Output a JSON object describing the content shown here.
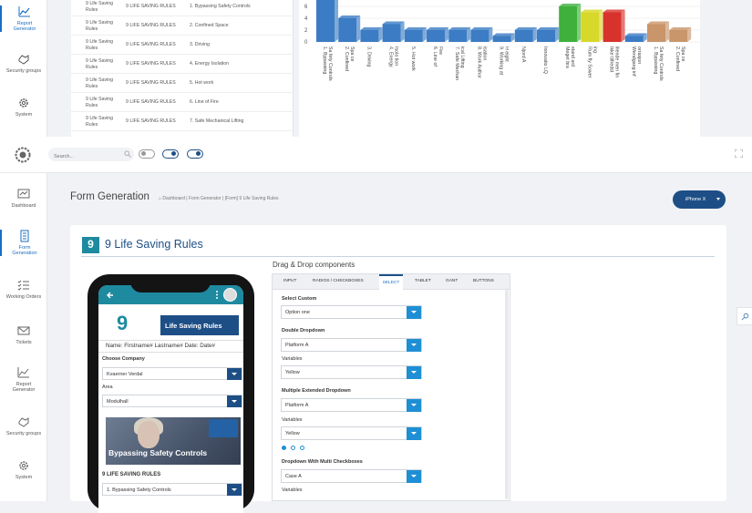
{
  "top": {
    "sidebar": [
      {
        "label_lines": [
          "Report",
          "Generator"
        ],
        "icon": "report-chart-icon",
        "active": true
      },
      {
        "label_lines": [
          "Security groups"
        ],
        "icon": "security-hands-icon",
        "active": false
      },
      {
        "label_lines": [
          "System"
        ],
        "icon": "gear-icon",
        "active": false
      }
    ],
    "list_rows": [
      {
        "name_lines": [
          "9 Life Saving",
          "Rules"
        ],
        "category": "9 LIFE SAVING RULES",
        "rule": "1. Bypassing Safety Controls"
      },
      {
        "name_lines": [
          "9 Life Saving",
          "Rules"
        ],
        "category": "9 LIFE SAVING RULES",
        "rule": "2. Confined Space"
      },
      {
        "name_lines": [
          "9 Life Saving",
          "Rules"
        ],
        "category": "9 LIFE SAVING RULES",
        "rule": "3. Driving"
      },
      {
        "name_lines": [
          "9 Life Saving",
          "Rules"
        ],
        "category": "9 LIFE SAVING RULES",
        "rule": "4. Energy Isolation"
      },
      {
        "name_lines": [
          "9 Life Saving",
          "Rules"
        ],
        "category": "9 LIFE SAVING RULES",
        "rule": "5. Hot work"
      },
      {
        "name_lines": [
          "9 Life Saving",
          "Rules"
        ],
        "category": "9 LIFE SAVING RULES",
        "rule": "6. Line of Fire"
      },
      {
        "name_lines": [
          "9 Life Saving",
          "Rules"
        ],
        "category": "9 LIFE SAVING RULES",
        "rule": "7. Safe Mechanical Lifting"
      }
    ]
  },
  "chart_data": {
    "type": "bar",
    "ylim": [
      0,
      10
    ],
    "yticks": [
      0,
      2,
      4,
      6
    ],
    "grid": true,
    "categories": [
      "1. Bypassing Sa fety Controls",
      "2. Confined Spa ce",
      "3. Driving",
      "4. Energy Isola tion",
      "5. Hot work",
      "6. Line of Fire",
      "7. Safe Mechan ical Lifting",
      "8. Work Author isation",
      "9. Working at H eight",
      "Njord A",
      "Innovatio LQ",
      "Meget bra stand ard",
      "Rum fly Sower ing",
      "Ikke tilfredst illende men fin",
      "Wendgang inf orrasjon",
      "1. Bypassing Sa fety Controls",
      "2. Confined Spa ce"
    ],
    "values": [
      10,
      4,
      2,
      3,
      2,
      2,
      2,
      2,
      1,
      2,
      2,
      6,
      5,
      5,
      1,
      3,
      2
    ],
    "colors": [
      "#3b7cc4",
      "#3b7cc4",
      "#3b7cc4",
      "#3b7cc4",
      "#3b7cc4",
      "#3b7cc4",
      "#3b7cc4",
      "#3b7cc4",
      "#3b7cc4",
      "#3b7cc4",
      "#3b7cc4",
      "#3fb03c",
      "#d8d82a",
      "#d8322c",
      "#3b7cc4",
      "#c9956a",
      "#c9956a"
    ]
  },
  "app": {
    "search_placeholder": "Search...",
    "sidebar": [
      {
        "label_lines": [
          "Dashboard"
        ],
        "icon": "dashboard-icon",
        "active": false
      },
      {
        "label_lines": [
          "Form",
          "Generation"
        ],
        "icon": "form-document-icon",
        "active": true
      },
      {
        "label_lines": [
          "Working Orders"
        ],
        "icon": "checklist-icon",
        "active": false
      },
      {
        "label_lines": [
          "Tickets"
        ],
        "icon": "envelope-icon",
        "active": false
      },
      {
        "label_lines": [
          "Report",
          "Generator"
        ],
        "icon": "report-chart-icon",
        "active": false
      },
      {
        "label_lines": [
          "Security groups"
        ],
        "icon": "security-hands-icon",
        "active": false
      },
      {
        "label_lines": [
          "System"
        ],
        "icon": "gear-icon",
        "active": false
      }
    ],
    "page_title": "Form Generation",
    "breadcrumbs": "Dashboard  |  Form Generator  |  [Form] 9 Life Saving Rules",
    "device_button": "iPhone X",
    "form_brand_number": "9",
    "form_title": "9 Life Saving Rules",
    "accent": "#1d4f86",
    "teal": "#1e8a9f"
  },
  "phone": {
    "logo_number": "9",
    "logo_banner": "Life Saving Rules",
    "name_line": "Name: Firstname# Lastname# Date: Date#",
    "choose_company_label": "Choose Company",
    "company_value": "Kvaerner Verdal",
    "area_label": "Area",
    "area_value": "Modulhall",
    "image_caption": "Bypassing Safety Controls",
    "rules_heading": "9 LIFE SAVING RULES",
    "rule_value": "1. Bypassing Safety Controls"
  },
  "dnd": {
    "title": "Drag & Drop components",
    "tabs": [
      "INPUT",
      "RADIOS / CHECKBOXES",
      "SELECT",
      "TABLET",
      "GANT",
      "BUTTONS"
    ],
    "active_tab": "SELECT",
    "select_custom_label": "Select Custom",
    "select_custom_value": "Option one",
    "double_dropdown_label": "Double Dropdown",
    "double_dropdown_value": "Platform A",
    "variables_label": "Variables",
    "variables_value": "Yellow",
    "multi_extended_label": "Multiple Extended Dropdown",
    "multi_extended_value": "Platform A",
    "variables2_label": "Variables",
    "variables2_value": "Yellow",
    "multi_checkbox_label": "Dropdown With Multi Checkboxes",
    "multi_checkbox_value": "Case A",
    "variables3_label": "Variables"
  }
}
